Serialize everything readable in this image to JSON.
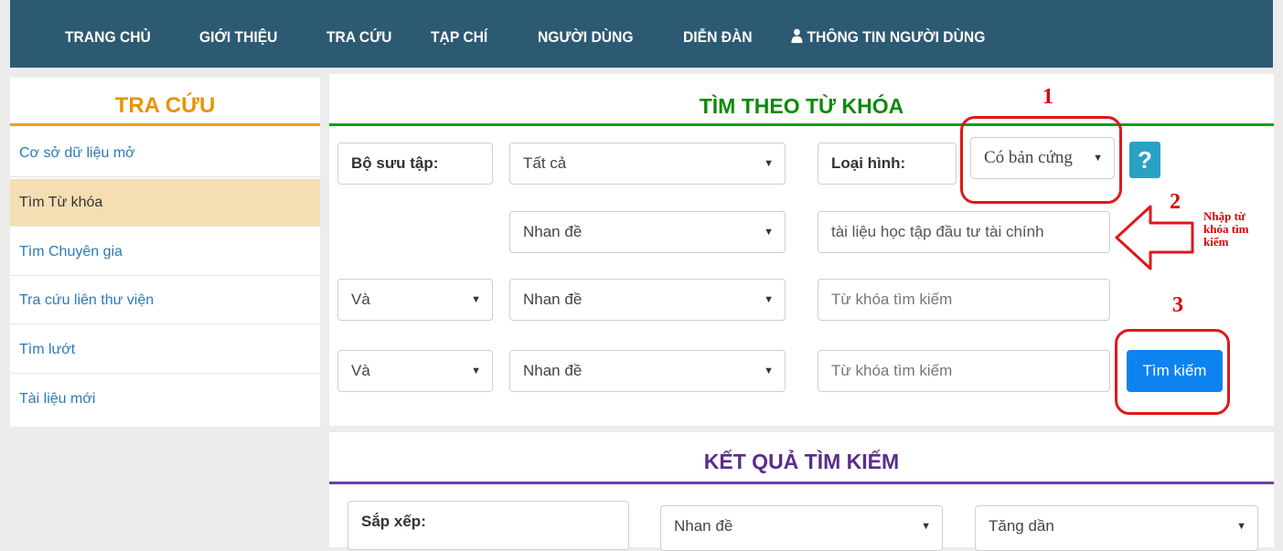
{
  "nav": {
    "home": "TRANG CHỦ",
    "about": "GIỚI THIỆU",
    "search": "TRA CỨU",
    "journal": "TẠP CHÍ",
    "users": "NGƯỜI DÙNG",
    "forum": "DIỄN ĐÀN",
    "user_info": "THÔNG TIN NGƯỜI DÙNG",
    "user_icon": "user-icon"
  },
  "sidebar": {
    "title": "TRA CỨU",
    "items": [
      {
        "label": "Cơ sở dữ liệu mở"
      },
      {
        "label": "Tìm Từ khóa"
      },
      {
        "label": "Tìm Chuyên gia"
      },
      {
        "label": "Tra cứu liên thư viện"
      },
      {
        "label": "Tìm lướt"
      },
      {
        "label": "Tài liệu mới"
      }
    ]
  },
  "keyword_search": {
    "title": "TÌM THEO TỪ KHÓA",
    "collection_label": "Bộ sưu tập:",
    "collection_value": "Tất cả",
    "type_label": "Loại hình:",
    "type_value": "Có bản cứng",
    "help_label": "?",
    "rows": [
      {
        "field": "Nhan đề",
        "keyword": "tài liệu học tập đầu tư tài chính"
      },
      {
        "operator": "Và",
        "field": "Nhan đề",
        "placeholder": "Từ khóa tìm kiếm"
      },
      {
        "operator": "Và",
        "field": "Nhan đề",
        "placeholder": "Từ khóa tìm kiếm"
      }
    ],
    "search_button": "Tìm kiếm"
  },
  "results": {
    "title": "KẾT QUẢ TÌM KIẾM",
    "sort_label": "Sắp xếp:",
    "sort_field": "Nhan đề",
    "sort_order": "Tăng dần"
  },
  "annotations": {
    "step1": "1",
    "step2": "2",
    "step3": "3",
    "note_lines": [
      "Nhập từ",
      "khóa tìm",
      "kiếm"
    ]
  },
  "colors": {
    "nav_bg": "#2c5a73",
    "sidebar_title": "#e69500",
    "section_title_green": "#0b8a0b",
    "section_title_purple": "#5b2c8e",
    "search_button": "#0d83f0",
    "help_button": "#2aa1c4",
    "annotation_red": "#e01818"
  }
}
